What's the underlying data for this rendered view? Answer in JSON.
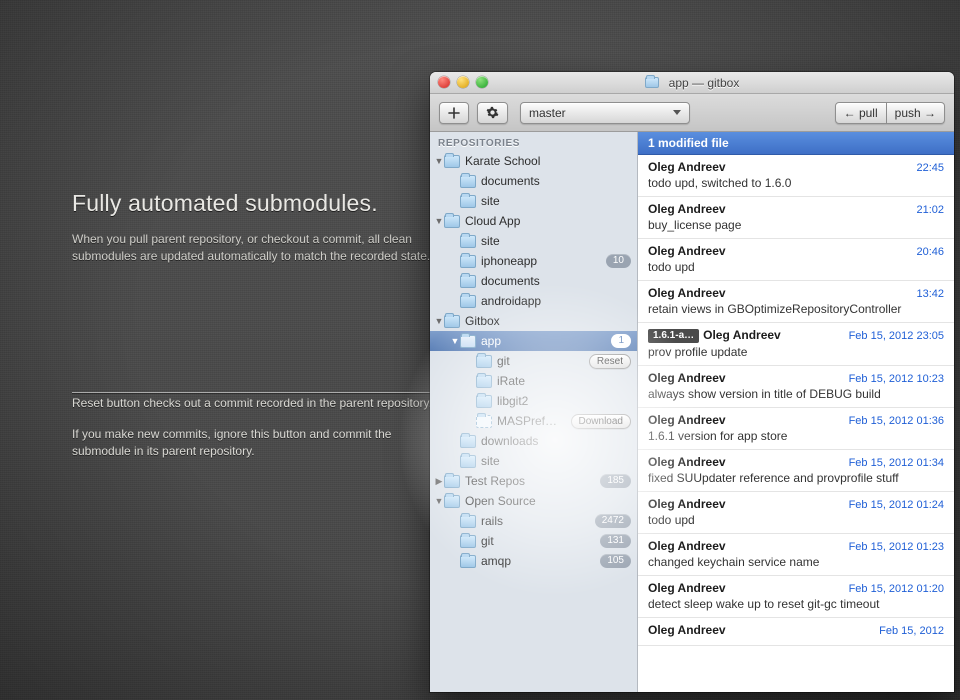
{
  "promo": {
    "title": "Fully automated submodules.",
    "desc": "When you pull parent repository, or checkout a commit, all clean submodules are updated automatically to match the recorded state.",
    "note1": "Reset button checks out a commit recorded in the parent repository.",
    "note2": "If you make new commits, ignore this button and commit the submodule in its parent repository."
  },
  "window": {
    "title": "app — gitbox",
    "toolbar": {
      "branch": "master",
      "pull": "← pull",
      "push": "push →"
    }
  },
  "sidebar": {
    "section": "REPOSITORIES",
    "reset_label": "Reset",
    "download_label": "Download",
    "tree": [
      {
        "depth": 0,
        "disc": "▼",
        "name": "Karate School"
      },
      {
        "depth": 1,
        "disc": "",
        "name": "documents"
      },
      {
        "depth": 1,
        "disc": "",
        "name": "site"
      },
      {
        "depth": 0,
        "disc": "▼",
        "name": "Cloud App"
      },
      {
        "depth": 1,
        "disc": "",
        "name": "site"
      },
      {
        "depth": 1,
        "disc": "",
        "name": "iphoneapp",
        "badge": "10"
      },
      {
        "depth": 1,
        "disc": "",
        "name": "documents"
      },
      {
        "depth": 1,
        "disc": "",
        "name": "androidapp"
      },
      {
        "depth": 0,
        "disc": "▼",
        "name": "Gitbox"
      },
      {
        "depth": 1,
        "disc": "▼",
        "name": "app",
        "badge": "1",
        "selected": true
      },
      {
        "depth": 2,
        "disc": "",
        "name": "git",
        "action": "reset"
      },
      {
        "depth": 2,
        "disc": "",
        "name": "iRate"
      },
      {
        "depth": 2,
        "disc": "",
        "name": "libgit2"
      },
      {
        "depth": 2,
        "disc": "",
        "name": "MASPref…",
        "dashed": true,
        "action": "download"
      },
      {
        "depth": 1,
        "disc": "",
        "name": "downloads"
      },
      {
        "depth": 1,
        "disc": "",
        "name": "site"
      },
      {
        "depth": 0,
        "disc": "▶",
        "name": "Test Repos",
        "badge": "185"
      },
      {
        "depth": 0,
        "disc": "▼",
        "name": "Open Source"
      },
      {
        "depth": 1,
        "disc": "",
        "name": "rails",
        "badge": "2472"
      },
      {
        "depth": 1,
        "disc": "",
        "name": "git",
        "badge": "131"
      },
      {
        "depth": 1,
        "disc": "",
        "name": "amqp",
        "badge": "105"
      }
    ]
  },
  "commits": {
    "status": "1 modified file",
    "list": [
      {
        "author": "Oleg Andreev",
        "time": "22:45",
        "msg": "todo upd, switched to 1.6.0"
      },
      {
        "author": "Oleg Andreev",
        "time": "21:02",
        "msg": "buy_license page"
      },
      {
        "author": "Oleg Andreev",
        "time": "20:46",
        "msg": "todo upd"
      },
      {
        "author": "Oleg Andreev",
        "time": "13:42",
        "msg": "retain views in GBOptimizeRepositoryController"
      },
      {
        "author": "Oleg Andreev",
        "time": "Feb 15, 2012 23:05",
        "msg": "prov profile update",
        "tag": "1.6.1-a…"
      },
      {
        "author": "Oleg Andreev",
        "time": "Feb 15, 2012 10:23",
        "msg": "always show version in title of DEBUG build"
      },
      {
        "author": "Oleg Andreev",
        "time": "Feb 15, 2012 01:36",
        "msg": "1.6.1 version for app store"
      },
      {
        "author": "Oleg Andreev",
        "time": "Feb 15, 2012 01:34",
        "msg": "fixed SUUpdater reference and provprofile stuff"
      },
      {
        "author": "Oleg Andreev",
        "time": "Feb 15, 2012 01:24",
        "msg": "todo upd"
      },
      {
        "author": "Oleg Andreev",
        "time": "Feb 15, 2012 01:23",
        "msg": "changed keychain service name"
      },
      {
        "author": "Oleg Andreev",
        "time": "Feb 15, 2012 01:20",
        "msg": "detect sleep wake up to reset git-gc timeout"
      },
      {
        "author": "Oleg Andreev",
        "time": "Feb 15, 2012",
        "msg": ""
      }
    ]
  }
}
